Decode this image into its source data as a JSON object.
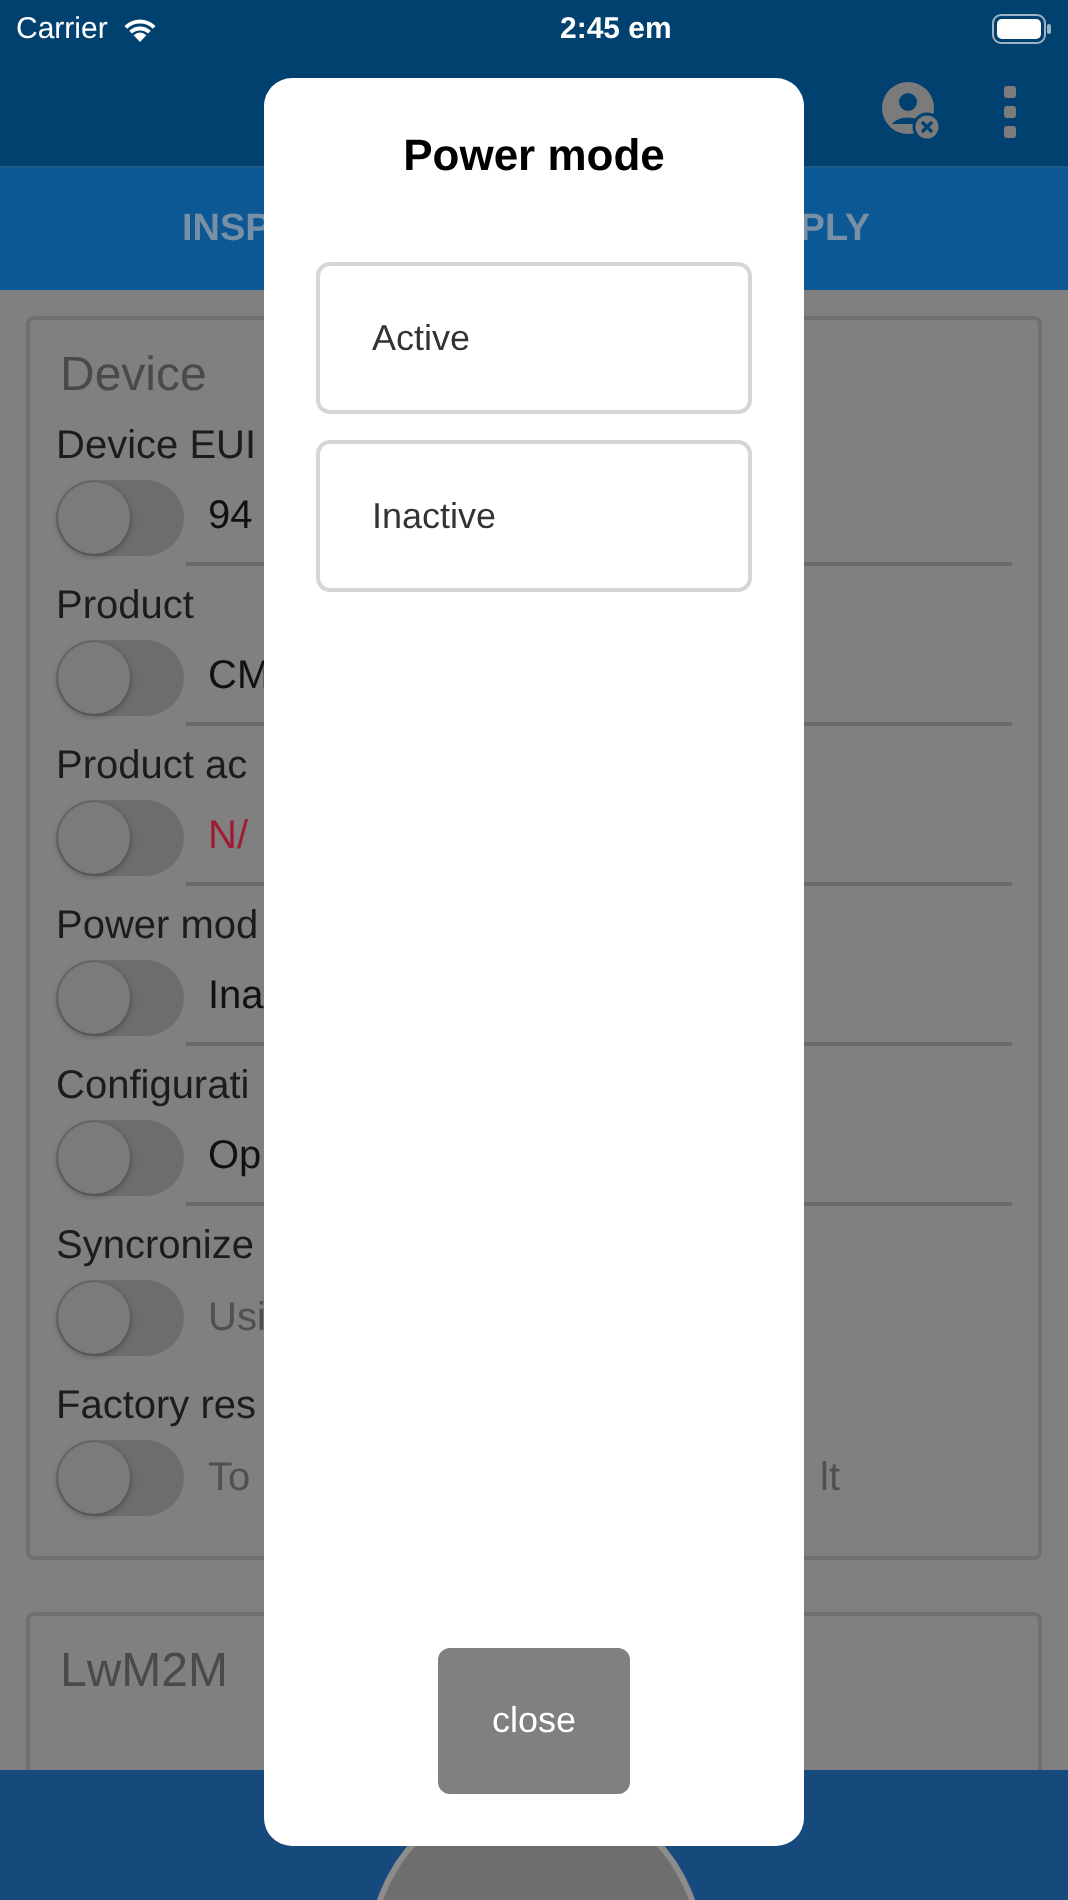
{
  "status_bar": {
    "carrier": "Carrier",
    "time": "2:45 em"
  },
  "tabs": [
    {
      "label": "INSP",
      "selected": false
    },
    {
      "label": "PLY",
      "selected": false
    }
  ],
  "device_card": {
    "title": "Device",
    "fields": [
      {
        "label": "Device EUI",
        "value": "94",
        "kind": "field",
        "on": false
      },
      {
        "label": "Product",
        "value": "CM",
        "kind": "field",
        "on": false
      },
      {
        "label": "Product ac",
        "value": "N/",
        "kind": "error",
        "on": false
      },
      {
        "label": "Power mod",
        "value": "Ina",
        "kind": "field",
        "on": false
      },
      {
        "label": "Configurati",
        "value": "Op",
        "kind": "field",
        "on": false
      },
      {
        "label": "Syncronize",
        "value": "Usi",
        "kind": "note",
        "on": false
      },
      {
        "label": "Factory res",
        "value": "To",
        "value_right": "lt",
        "kind": "note",
        "on": false
      }
    ]
  },
  "lwm2m_card": {
    "title": "LwM2M"
  },
  "dialog": {
    "title": "Power mode",
    "options": [
      {
        "label": "Active"
      },
      {
        "label": "Inactive"
      }
    ],
    "close_button": "close"
  }
}
